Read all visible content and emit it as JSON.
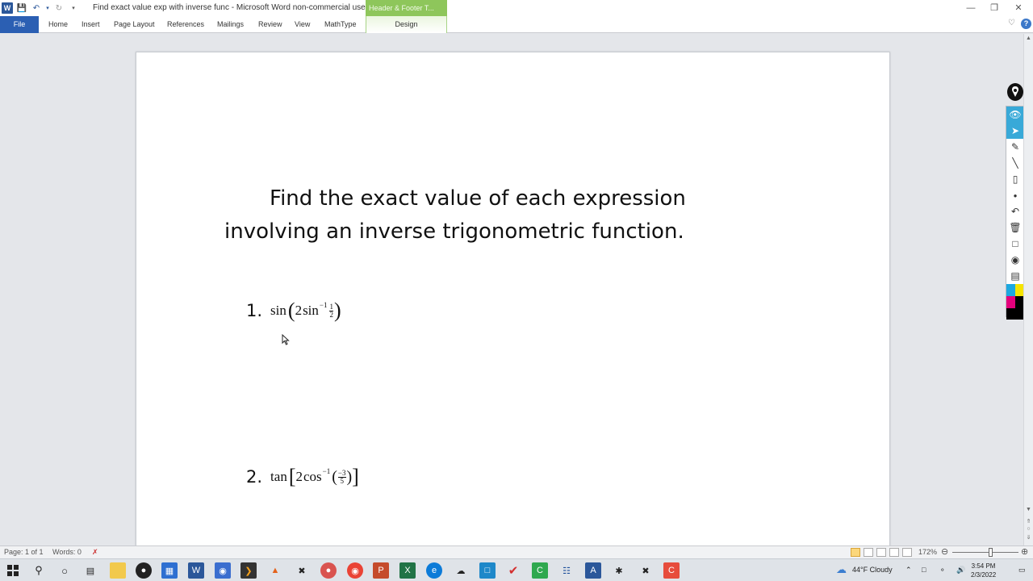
{
  "window": {
    "title": "Find exact value exp with inverse func  -  Microsoft Word non-commercial use",
    "context_tab_group": "Header & Footer T..."
  },
  "ribbon": {
    "tabs": [
      "File",
      "Home",
      "Insert",
      "Page Layout",
      "References",
      "Mailings",
      "Review",
      "View",
      "MathType",
      "Design"
    ]
  },
  "document": {
    "heading_line1": "Find the exact value of each expression",
    "heading_line2": "involving an inverse trigonometric function.",
    "problems": [
      {
        "number": "1.",
        "func": "sin",
        "coef": "2",
        "inner_func": "sin",
        "exponent": "−1",
        "frac_num": "1",
        "frac_den": "2"
      },
      {
        "number": "2.",
        "func": "tan",
        "coef": "2",
        "inner_func": "cos",
        "exponent": "−1",
        "frac_num": "−3",
        "frac_den": "5"
      }
    ]
  },
  "statusbar": {
    "page": "Page: 1 of 1",
    "words": "Words: 0",
    "zoom": "172%"
  },
  "taskbar": {
    "weather": "44°F  Cloudy",
    "time": "3:54 PM",
    "date": "2/3/2022"
  },
  "colors": {
    "file_tab": "#2b5fb3",
    "context_tab": "#8ec65b",
    "highlight_tool": "#38a9d8"
  }
}
